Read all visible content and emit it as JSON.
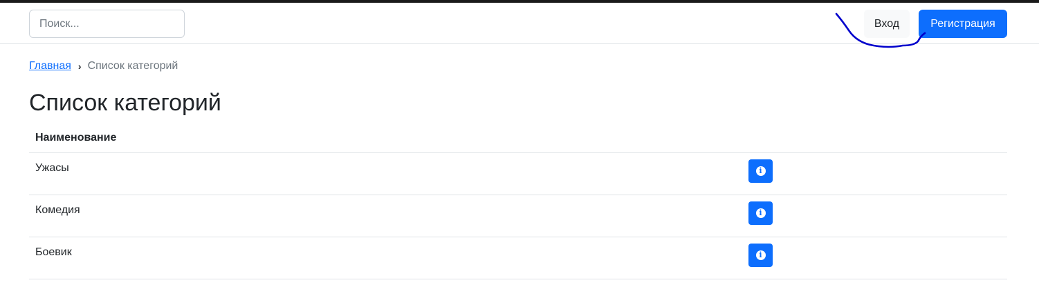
{
  "header": {
    "search": {
      "placeholder": "Поиск..."
    },
    "login_label": "Вход",
    "register_label": "Регистрация"
  },
  "breadcrumb": {
    "home_label": "Главная",
    "separator": "›",
    "current_label": "Список категорий"
  },
  "page_title": "Список категорий",
  "table": {
    "columns": [
      "Наименование",
      ""
    ],
    "rows": [
      {
        "name": "Ужасы",
        "action_icon": "info-icon"
      },
      {
        "name": "Комедия",
        "action_icon": "info-icon"
      },
      {
        "name": "Боевик",
        "action_icon": "info-icon"
      }
    ]
  },
  "colors": {
    "primary": "#0d6efd",
    "annotation_scribble": "#0000cc"
  }
}
